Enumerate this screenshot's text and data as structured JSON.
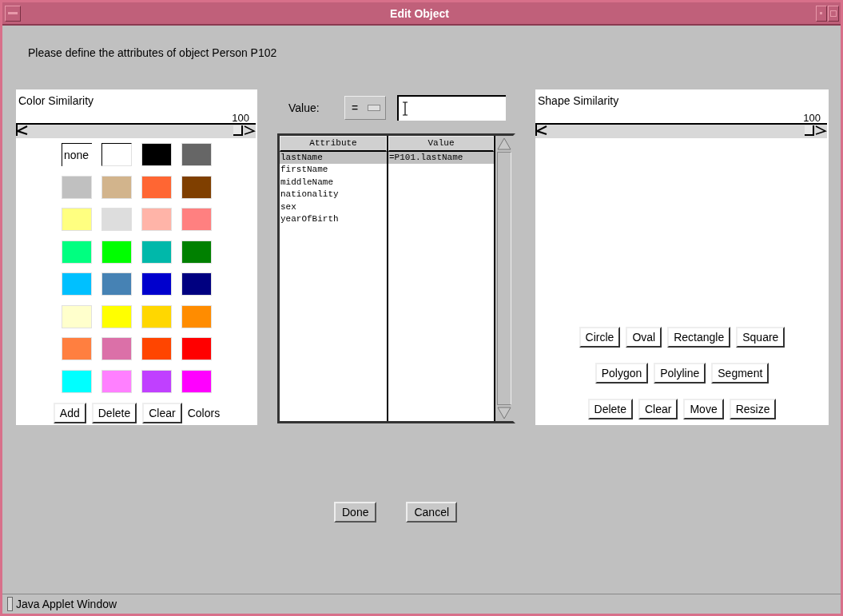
{
  "window": {
    "title": "Edit Object"
  },
  "message": "Please define the attributes of object Person P102",
  "color_panel": {
    "title": "Color Similarity",
    "slider": {
      "reading": "100",
      "level": 1
    },
    "swatches": [
      {
        "kind": "text",
        "label": "none"
      },
      {
        "kind": "color",
        "color": "#ffffff"
      },
      {
        "kind": "color",
        "color": "#000000"
      },
      {
        "kind": "color",
        "color": "#666666"
      },
      {
        "kind": "color",
        "color": "#c0c0c0"
      },
      {
        "kind": "color",
        "color": "#d2b48c"
      },
      {
        "kind": "color",
        "color": "#ff6633"
      },
      {
        "kind": "color",
        "color": "#7f3f00"
      },
      {
        "kind": "color",
        "color": "#ffff80"
      },
      {
        "kind": "color",
        "color": "#dddddd"
      },
      {
        "kind": "color",
        "color": "#ffb4a8"
      },
      {
        "kind": "color",
        "color": "#ff8080"
      },
      {
        "kind": "color",
        "color": "#00ff80"
      },
      {
        "kind": "color",
        "color": "#00ff00"
      },
      {
        "kind": "color",
        "color": "#00b8aa"
      },
      {
        "kind": "color",
        "color": "#008000"
      },
      {
        "kind": "color",
        "color": "#00c0ff"
      },
      {
        "kind": "color",
        "color": "#4682b4"
      },
      {
        "kind": "color",
        "color": "#0000cd"
      },
      {
        "kind": "color",
        "color": "#000080"
      },
      {
        "kind": "color",
        "color": "#ffffcc"
      },
      {
        "kind": "color",
        "color": "#ffff00"
      },
      {
        "kind": "color",
        "color": "#ffd700"
      },
      {
        "kind": "color",
        "color": "#ff8c00"
      },
      {
        "kind": "color",
        "color": "#ff7f40"
      },
      {
        "kind": "color",
        "color": "#db70a8"
      },
      {
        "kind": "color",
        "color": "#ff4500"
      },
      {
        "kind": "color",
        "color": "#ff0000"
      },
      {
        "kind": "color",
        "color": "#00ffff"
      },
      {
        "kind": "color",
        "color": "#ff80ff"
      },
      {
        "kind": "color",
        "color": "#c040ff"
      },
      {
        "kind": "color",
        "color": "#ff00ff"
      }
    ],
    "buttons": [
      "Add",
      "Delete",
      "Clear"
    ],
    "footer_label": "Colors"
  },
  "value_row": {
    "label": "Value:",
    "operator": "="
  },
  "table": {
    "columns": [
      "Attribute",
      "Value"
    ],
    "rows": [
      {
        "attribute": "lastName",
        "value": "=P101.lastName",
        "selected": true
      },
      {
        "attribute": "firstName",
        "selected": false
      },
      {
        "attribute": "middleName",
        "selected": false
      },
      {
        "attribute": "nationality",
        "selected": false
      },
      {
        "attribute": "sex",
        "selected": false
      },
      {
        "attribute": "yearOfBirth",
        "selected": false
      }
    ]
  },
  "shape_panel": {
    "title": "Shape Similarity",
    "slider": {
      "reading": "100",
      "level": 1
    },
    "button_rows": [
      [
        "Circle",
        "Oval",
        "Rectangle",
        "Square"
      ],
      [
        "Polygon",
        "Polyline",
        "Segment"
      ],
      [
        "Delete",
        "Clear",
        "Move",
        "Resize"
      ]
    ]
  },
  "buttons": [
    "Done",
    "Cancel"
  ],
  "status_bar": "Java Applet Window"
}
